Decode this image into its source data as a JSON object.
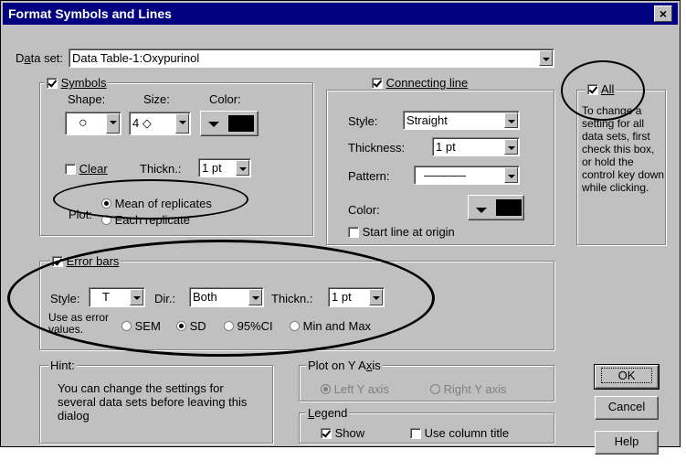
{
  "window": {
    "title": "Format Symbols and Lines",
    "close": "×"
  },
  "dataset": {
    "label": "Data set:",
    "value": "Data Table-1:Oxypurinol"
  },
  "symbols": {
    "title": "Symbols",
    "checked": true,
    "shape_label": "Shape:",
    "size_label": "Size:",
    "color_label": "Color:",
    "shape_value": "○",
    "size_value": "4 ◇",
    "clear_label": "Clear",
    "clear_checked": false,
    "thickn_label": "Thickn.:",
    "thickn_value": "1 pt",
    "plot_label": "Plot:",
    "plot_options": [
      "Mean of replicates",
      "Each replicate"
    ],
    "plot_selected": "Mean of replicates"
  },
  "connecting_line": {
    "title": "Connecting line",
    "checked": true,
    "style_label": "Style:",
    "style_value": "Straight",
    "thickness_label": "Thickness:",
    "thickness_value": "1 pt",
    "pattern_label": "Pattern:",
    "pattern_value": "————",
    "color_label": "Color:",
    "start_origin_label": "Start line at origin",
    "start_origin_checked": false
  },
  "all": {
    "label": "All",
    "checked": true,
    "help_text": "To change a setting for all data sets, first check this box, or hold the control key down while clicking."
  },
  "error_bars": {
    "title": "Error bars",
    "checked": true,
    "style_label": "Style:",
    "style_value": "T",
    "dir_label": "Dir.:",
    "dir_value": "Both",
    "thickn_label": "Thickn.:",
    "thickn_value": "1 pt",
    "use_as_label": "Use as error values.",
    "options": [
      "SEM",
      "SD",
      "95%CI",
      "Min and Max"
    ],
    "selected": "SD"
  },
  "hint": {
    "title": "Hint:",
    "text": "You can change the settings for several data sets before leaving this dialog"
  },
  "plot_y_axis": {
    "title": "Plot on Y Axis",
    "left": "Left Y axis",
    "right": "Right Y axis",
    "selected": "Left Y axis"
  },
  "legend": {
    "title": "Legend",
    "show_label": "Show",
    "show_checked": true,
    "use_column_label": "Use column title",
    "use_column_checked": false
  },
  "buttons": {
    "ok": "OK",
    "cancel": "Cancel",
    "help": "Help"
  },
  "colors": {
    "title_bar": "#000080",
    "dialog_bg": "#c0c0c0",
    "annotation": "#000000"
  }
}
